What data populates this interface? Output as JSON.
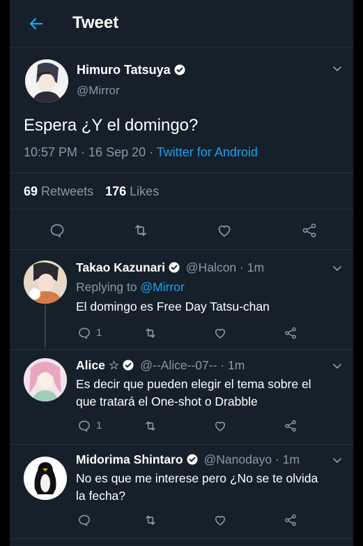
{
  "header": {
    "title": "Tweet"
  },
  "tweet": {
    "author_name": "Himuro Tatsuya",
    "handle": "@Mirror",
    "text": "Espera ¿Y el domingo?",
    "time": "10:57 PM · 16 Sep 20 · ",
    "source": "Twitter for Android",
    "retweets_count": "69",
    "retweets_label": "Retweets",
    "likes_count": "176",
    "likes_label": "Likes"
  },
  "replies": [
    {
      "name": "Takao Kazunari",
      "handle": "@Halcon",
      "time": "· 1m",
      "replying_prefix": "Replying to ",
      "replying_to": "@Mirror",
      "text": "El domingo es Free Day Tatsu-chan",
      "reply_count": "1"
    },
    {
      "name": "Alice ☆",
      "handle": "@--Alice--07--",
      "time": "· 1m",
      "text_line1": "Es decir que pueden elegir el tema sobre el",
      "text_line2": "que tratará el One-shot o Drabble",
      "reply_count": "1"
    },
    {
      "name": "Midorima Shintaro",
      "handle": "@Nanodayo",
      "time": "· 1m",
      "text_line1": "No es que me interese pero ¿No se te olvida",
      "text_line2": "la fecha?"
    }
  ],
  "colors": {
    "background": "#15202b",
    "accent": "#1da1f2",
    "muted": "#8899a6",
    "divider": "#253341"
  }
}
